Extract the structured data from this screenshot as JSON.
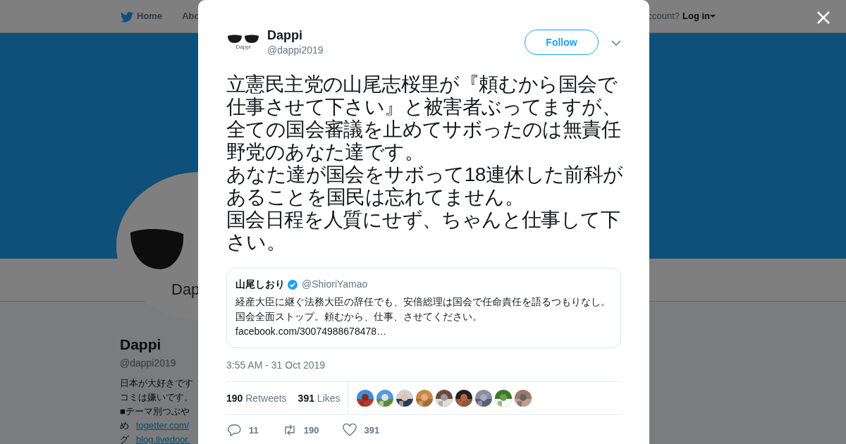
{
  "background_page": {
    "nav": {
      "home": "Home",
      "about": "Abo",
      "account_prompt": "ccount?",
      "login": "Log in"
    },
    "profile": {
      "name": "Dappi",
      "handle": "@dappi2019",
      "avatar_caption": "Dap",
      "bio": [
        {
          "kind": "text",
          "text": "日本が大好きです"
        },
        {
          "kind": "text",
          "text": "コミは嫌いです。"
        },
        {
          "kind": "text",
          "text": "■テーマ別つぶや"
        },
        {
          "kind": "link",
          "prefix": "め",
          "text": "togetter.com/"
        },
        {
          "kind": "link",
          "prefix": "グ",
          "text": "blog.livedoor."
        }
      ]
    }
  },
  "tweet": {
    "author": {
      "name": "Dappi",
      "handle": "@dappi2019",
      "logo_caption": "Dappi"
    },
    "follow_button": "Follow",
    "text": [
      "立憲民主党の山尾志桜里が『頼むから国会で仕事させて下さい』と被害者ぶってますが、全ての国会審議を止めてサボったのは無責任野党のあなた達です。",
      "あなた達が国会をサボって18連休した前科があることを国民は忘れてません。",
      "国会日程を人質にせず、ちゃんと仕事して下さい。"
    ],
    "quoted": {
      "name": "山尾しおり",
      "verified": true,
      "handle": "@ShioriYamao",
      "lines": [
        "経産大臣に継ぐ法務大臣の辞任でも、安倍総理は国会で任命責任を語るつもりなし。",
        "国会全面ストップ。頼むから、仕事、させてください。"
      ],
      "link": "facebook.com/30074988678478…"
    },
    "timestamp": "3:55 AM - 31 Oct 2019",
    "stats": [
      {
        "count": "190",
        "label": "Retweets"
      },
      {
        "count": "391",
        "label": "Likes"
      }
    ],
    "actions": [
      {
        "kind": "reply",
        "count": "11"
      },
      {
        "kind": "retweet",
        "count": "190"
      },
      {
        "kind": "like",
        "count": "391"
      }
    ]
  }
}
